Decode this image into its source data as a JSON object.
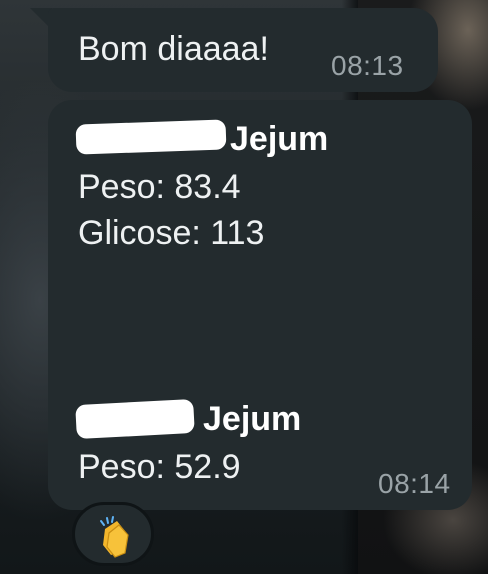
{
  "messages": [
    {
      "text": "Bom diaaaa!",
      "time": "08:13"
    },
    {
      "entries": [
        {
          "label_suffix": "Jejum",
          "lines": [
            "Peso: 83.4",
            "Glicose: 113"
          ]
        },
        {
          "label_suffix": "Jejum",
          "lines": [
            "Peso: 52.9"
          ]
        }
      ],
      "time": "08:14"
    }
  ],
  "reaction": {
    "icon": "clapping-hands-icon",
    "emoji": "👏"
  },
  "colors": {
    "bubble": "#232b2e",
    "text": "#eef1f2",
    "timestamp": "#9aa3a7"
  }
}
